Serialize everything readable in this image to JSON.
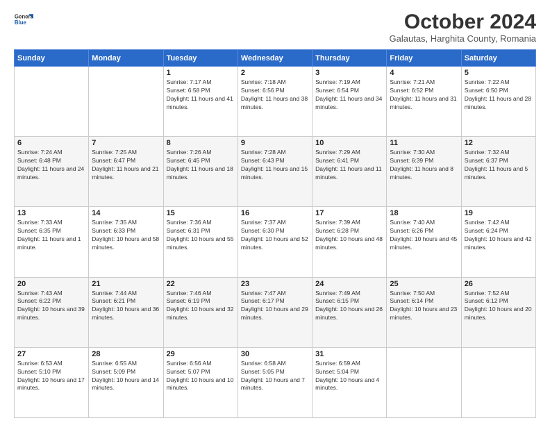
{
  "header": {
    "logo": {
      "line1": "General",
      "line2": "Blue"
    },
    "title": "October 2024",
    "subtitle": "Galautas, Harghita County, Romania"
  },
  "weekdays": [
    "Sunday",
    "Monday",
    "Tuesday",
    "Wednesday",
    "Thursday",
    "Friday",
    "Saturday"
  ],
  "weeks": [
    [
      {
        "day": "",
        "sunrise": "",
        "sunset": "",
        "daylight": ""
      },
      {
        "day": "",
        "sunrise": "",
        "sunset": "",
        "daylight": ""
      },
      {
        "day": "1",
        "sunrise": "Sunrise: 7:17 AM",
        "sunset": "Sunset: 6:58 PM",
        "daylight": "Daylight: 11 hours and 41 minutes."
      },
      {
        "day": "2",
        "sunrise": "Sunrise: 7:18 AM",
        "sunset": "Sunset: 6:56 PM",
        "daylight": "Daylight: 11 hours and 38 minutes."
      },
      {
        "day": "3",
        "sunrise": "Sunrise: 7:19 AM",
        "sunset": "Sunset: 6:54 PM",
        "daylight": "Daylight: 11 hours and 34 minutes."
      },
      {
        "day": "4",
        "sunrise": "Sunrise: 7:21 AM",
        "sunset": "Sunset: 6:52 PM",
        "daylight": "Daylight: 11 hours and 31 minutes."
      },
      {
        "day": "5",
        "sunrise": "Sunrise: 7:22 AM",
        "sunset": "Sunset: 6:50 PM",
        "daylight": "Daylight: 11 hours and 28 minutes."
      }
    ],
    [
      {
        "day": "6",
        "sunrise": "Sunrise: 7:24 AM",
        "sunset": "Sunset: 6:48 PM",
        "daylight": "Daylight: 11 hours and 24 minutes."
      },
      {
        "day": "7",
        "sunrise": "Sunrise: 7:25 AM",
        "sunset": "Sunset: 6:47 PM",
        "daylight": "Daylight: 11 hours and 21 minutes."
      },
      {
        "day": "8",
        "sunrise": "Sunrise: 7:26 AM",
        "sunset": "Sunset: 6:45 PM",
        "daylight": "Daylight: 11 hours and 18 minutes."
      },
      {
        "day": "9",
        "sunrise": "Sunrise: 7:28 AM",
        "sunset": "Sunset: 6:43 PM",
        "daylight": "Daylight: 11 hours and 15 minutes."
      },
      {
        "day": "10",
        "sunrise": "Sunrise: 7:29 AM",
        "sunset": "Sunset: 6:41 PM",
        "daylight": "Daylight: 11 hours and 11 minutes."
      },
      {
        "day": "11",
        "sunrise": "Sunrise: 7:30 AM",
        "sunset": "Sunset: 6:39 PM",
        "daylight": "Daylight: 11 hours and 8 minutes."
      },
      {
        "day": "12",
        "sunrise": "Sunrise: 7:32 AM",
        "sunset": "Sunset: 6:37 PM",
        "daylight": "Daylight: 11 hours and 5 minutes."
      }
    ],
    [
      {
        "day": "13",
        "sunrise": "Sunrise: 7:33 AM",
        "sunset": "Sunset: 6:35 PM",
        "daylight": "Daylight: 11 hours and 1 minute."
      },
      {
        "day": "14",
        "sunrise": "Sunrise: 7:35 AM",
        "sunset": "Sunset: 6:33 PM",
        "daylight": "Daylight: 10 hours and 58 minutes."
      },
      {
        "day": "15",
        "sunrise": "Sunrise: 7:36 AM",
        "sunset": "Sunset: 6:31 PM",
        "daylight": "Daylight: 10 hours and 55 minutes."
      },
      {
        "day": "16",
        "sunrise": "Sunrise: 7:37 AM",
        "sunset": "Sunset: 6:30 PM",
        "daylight": "Daylight: 10 hours and 52 minutes."
      },
      {
        "day": "17",
        "sunrise": "Sunrise: 7:39 AM",
        "sunset": "Sunset: 6:28 PM",
        "daylight": "Daylight: 10 hours and 48 minutes."
      },
      {
        "day": "18",
        "sunrise": "Sunrise: 7:40 AM",
        "sunset": "Sunset: 6:26 PM",
        "daylight": "Daylight: 10 hours and 45 minutes."
      },
      {
        "day": "19",
        "sunrise": "Sunrise: 7:42 AM",
        "sunset": "Sunset: 6:24 PM",
        "daylight": "Daylight: 10 hours and 42 minutes."
      }
    ],
    [
      {
        "day": "20",
        "sunrise": "Sunrise: 7:43 AM",
        "sunset": "Sunset: 6:22 PM",
        "daylight": "Daylight: 10 hours and 39 minutes."
      },
      {
        "day": "21",
        "sunrise": "Sunrise: 7:44 AM",
        "sunset": "Sunset: 6:21 PM",
        "daylight": "Daylight: 10 hours and 36 minutes."
      },
      {
        "day": "22",
        "sunrise": "Sunrise: 7:46 AM",
        "sunset": "Sunset: 6:19 PM",
        "daylight": "Daylight: 10 hours and 32 minutes."
      },
      {
        "day": "23",
        "sunrise": "Sunrise: 7:47 AM",
        "sunset": "Sunset: 6:17 PM",
        "daylight": "Daylight: 10 hours and 29 minutes."
      },
      {
        "day": "24",
        "sunrise": "Sunrise: 7:49 AM",
        "sunset": "Sunset: 6:15 PM",
        "daylight": "Daylight: 10 hours and 26 minutes."
      },
      {
        "day": "25",
        "sunrise": "Sunrise: 7:50 AM",
        "sunset": "Sunset: 6:14 PM",
        "daylight": "Daylight: 10 hours and 23 minutes."
      },
      {
        "day": "26",
        "sunrise": "Sunrise: 7:52 AM",
        "sunset": "Sunset: 6:12 PM",
        "daylight": "Daylight: 10 hours and 20 minutes."
      }
    ],
    [
      {
        "day": "27",
        "sunrise": "Sunrise: 6:53 AM",
        "sunset": "Sunset: 5:10 PM",
        "daylight": "Daylight: 10 hours and 17 minutes."
      },
      {
        "day": "28",
        "sunrise": "Sunrise: 6:55 AM",
        "sunset": "Sunset: 5:09 PM",
        "daylight": "Daylight: 10 hours and 14 minutes."
      },
      {
        "day": "29",
        "sunrise": "Sunrise: 6:56 AM",
        "sunset": "Sunset: 5:07 PM",
        "daylight": "Daylight: 10 hours and 10 minutes."
      },
      {
        "day": "30",
        "sunrise": "Sunrise: 6:58 AM",
        "sunset": "Sunset: 5:05 PM",
        "daylight": "Daylight: 10 hours and 7 minutes."
      },
      {
        "day": "31",
        "sunrise": "Sunrise: 6:59 AM",
        "sunset": "Sunset: 5:04 PM",
        "daylight": "Daylight: 10 hours and 4 minutes."
      },
      {
        "day": "",
        "sunrise": "",
        "sunset": "",
        "daylight": ""
      },
      {
        "day": "",
        "sunrise": "",
        "sunset": "",
        "daylight": ""
      }
    ]
  ]
}
